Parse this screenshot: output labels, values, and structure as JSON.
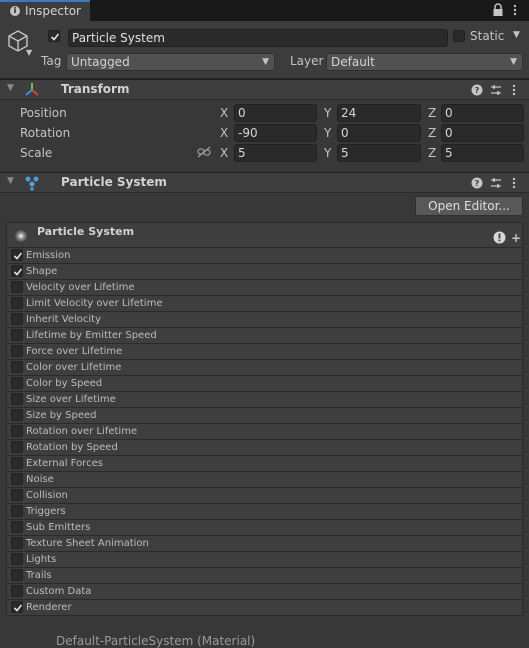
{
  "tab": {
    "icon": "info-icon",
    "label": "Inspector"
  },
  "header": {
    "object_icon": "cube-icon",
    "active": true,
    "name": "Particle System",
    "static_label": "Static",
    "static": false,
    "tag_label": "Tag",
    "tag_value": "Untagged",
    "layer_label": "Layer",
    "layer_value": "Default"
  },
  "transform": {
    "title": "Transform",
    "rows": [
      {
        "label": "Position",
        "x_label": "X",
        "x": "0",
        "y_label": "Y",
        "y": "24",
        "z_label": "Z",
        "z": "0"
      },
      {
        "label": "Rotation",
        "x_label": "X",
        "x": "-90",
        "y_label": "Y",
        "y": "0",
        "z_label": "Z",
        "z": "0"
      },
      {
        "label": "Scale",
        "x_label": "X",
        "x": "5",
        "y_label": "Y",
        "y": "5",
        "z_label": "Z",
        "z": "5"
      }
    ]
  },
  "particle_system": {
    "title": "Particle System",
    "open_editor_label": "Open Editor...",
    "main_module_title": "Particle System",
    "modules": [
      {
        "label": "Emission",
        "checked": true
      },
      {
        "label": "Shape",
        "checked": true
      },
      {
        "label": "Velocity over Lifetime",
        "checked": false
      },
      {
        "label": "Limit Velocity over Lifetime",
        "checked": false
      },
      {
        "label": "Inherit Velocity",
        "checked": false
      },
      {
        "label": "Lifetime by Emitter Speed",
        "checked": false
      },
      {
        "label": "Force over Lifetime",
        "checked": false
      },
      {
        "label": "Color over Lifetime",
        "checked": false
      },
      {
        "label": "Color by Speed",
        "checked": false
      },
      {
        "label": "Size over Lifetime",
        "checked": false
      },
      {
        "label": "Size by Speed",
        "checked": false
      },
      {
        "label": "Rotation over Lifetime",
        "checked": false
      },
      {
        "label": "Rotation by Speed",
        "checked": false
      },
      {
        "label": "External Forces",
        "checked": false
      },
      {
        "label": "Noise",
        "checked": false
      },
      {
        "label": "Collision",
        "checked": false
      },
      {
        "label": "Triggers",
        "checked": false
      },
      {
        "label": "Sub Emitters",
        "checked": false
      },
      {
        "label": "Texture Sheet Animation",
        "checked": false
      },
      {
        "label": "Lights",
        "checked": false
      },
      {
        "label": "Trails",
        "checked": false
      },
      {
        "label": "Custom Data",
        "checked": false
      },
      {
        "label": "Renderer",
        "checked": true
      }
    ]
  },
  "footer": {
    "label": "Default-ParticleSystem (Material)"
  },
  "colors": {
    "panel": "#383838",
    "accent": "#3a79bb",
    "field": "#2a2a2a"
  }
}
